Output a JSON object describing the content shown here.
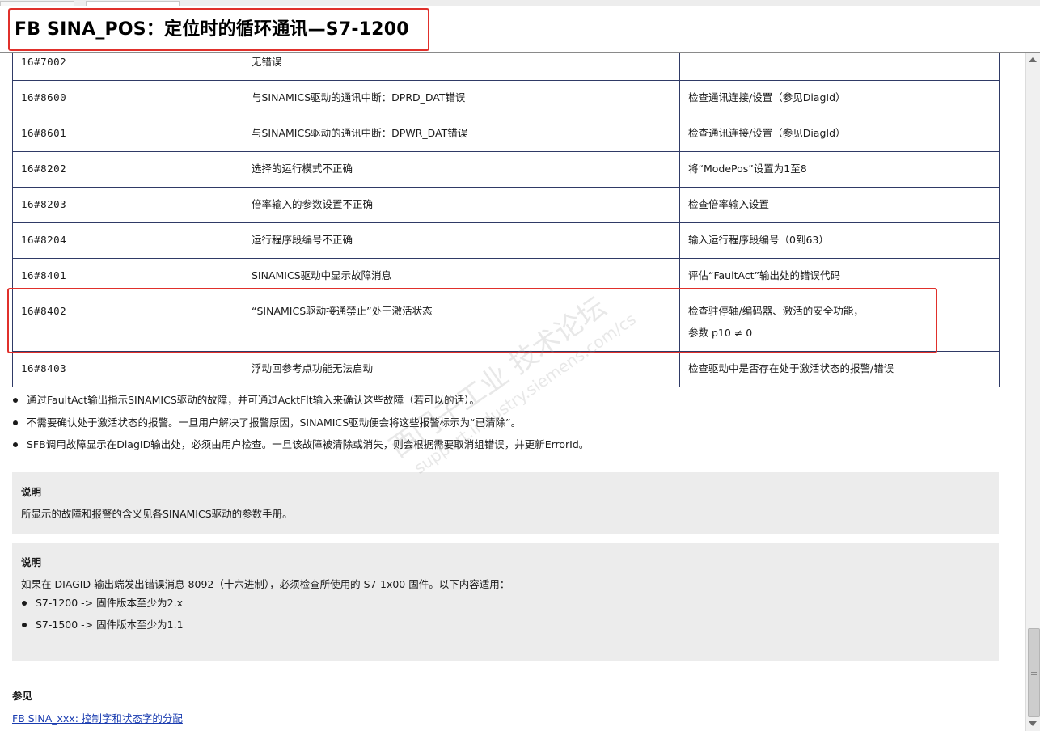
{
  "title": "FB SINA_POS：定位时的循环通讯—S7-1200",
  "table": {
    "rows": [
      {
        "code": "16#7002",
        "description": "无错误",
        "remedy": ""
      },
      {
        "code": "16#8600",
        "description": "与SINAMICS驱动的通讯中断：DPRD_DAT错误",
        "remedy": "检查通讯连接/设置（参见DiagId）"
      },
      {
        "code": "16#8601",
        "description": "与SINAMICS驱动的通讯中断：DPWR_DAT错误",
        "remedy": "检查通讯连接/设置（参见DiagId）"
      },
      {
        "code": "16#8202",
        "description": "选择的运行模式不正确",
        "remedy": "将“ModePos”设置为1至8"
      },
      {
        "code": "16#8203",
        "description": "倍率输入的参数设置不正确",
        "remedy": "检查倍率输入设置"
      },
      {
        "code": "16#8204",
        "description": "运行程序段编号不正确",
        "remedy": "输入运行程序段编号（0到63）"
      },
      {
        "code": "16#8401",
        "description": "SINAMICS驱动中显示故障消息",
        "remedy": "评估“FaultAct”输出处的错误代码"
      },
      {
        "code": "16#8402",
        "description": "“SINAMICS驱动接通禁止”处于激活状态",
        "remedy": "检查驻停轴/编码器、激活的安全功能，",
        "remedy_line2": "参数 p10 ≠ 0"
      },
      {
        "code": "16#8403",
        "description": "浮动回参考点功能无法启动",
        "remedy": "检查驱动中是否存在处于激活状态的报警/错误"
      }
    ]
  },
  "bullets": [
    "通过FaultAct输出指示SINAMICS驱动的故障，并可通过AcktFlt输入来确认这些故障（若可以的话）。",
    "不需要确认处于激活状态的报警。一旦用户解决了报警原因，SINAMICS驱动便会将这些报警标示为“已清除”。",
    "SFB调用故障显示在DiagID输出处，必须由用户检查。一旦该故障被清除或消失，则会根据需要取消组错误，并更新ErrorId。"
  ],
  "note1": {
    "title": "说明",
    "text": "所显示的故障和报警的含义见各SINAMICS驱动的参数手册。"
  },
  "note2": {
    "title": "说明",
    "text": "如果在 DIAGID 输出端发出错误消息 8092（十六进制），必须检查所使用的 S7-1x00 固件。以下内容适用：",
    "items": [
      "S7-1200 -> 固件版本至少为2.x",
      "S7-1500 -> 固件版本至少为1.1"
    ]
  },
  "see_also": {
    "title": "参见",
    "link": "FB SINA_xxx: 控制字和状态字的分配"
  },
  "watermark": {
    "main": "西门子工业  技术论坛",
    "sub": "support.industry.siemens.com/cs"
  },
  "colors": {
    "highlight_box": "#e0302b",
    "table_border": "#2f3a66",
    "note_background": "#ececec",
    "link": "#1a3cb0"
  }
}
